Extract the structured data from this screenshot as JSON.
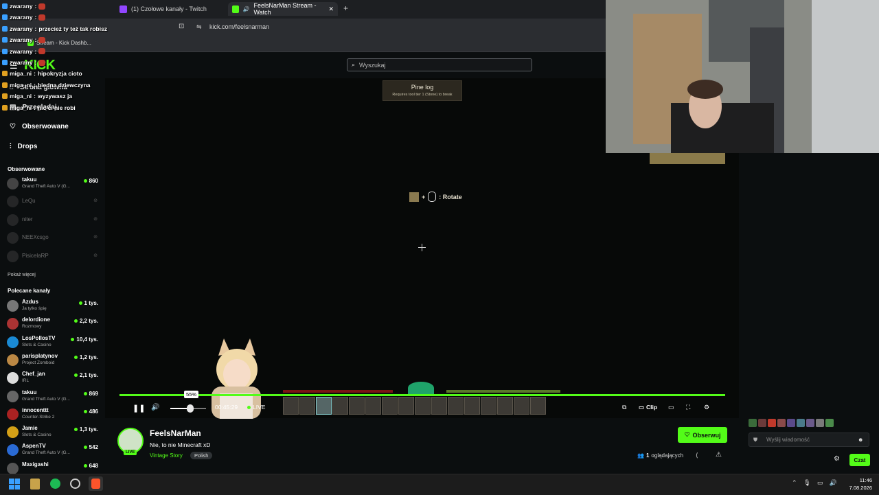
{
  "browser": {
    "tabs": [
      {
        "label": "(1) Czołowe kanały - Twitch",
        "active": false
      },
      {
        "label": "FeelsNarMan Stream - Watch",
        "active": true
      }
    ],
    "url": "kick.com/feelsnarman",
    "bookmark": "Stream - Kick Dashb..."
  },
  "kick": {
    "search_placeholder": "Wyszukaj",
    "nav": [
      "Strona główna",
      "Przeglądaj",
      "Obserwowane",
      "Drops"
    ],
    "followed_header": "Obserwowane",
    "followed": [
      {
        "name": "takuu",
        "category": "Grand Theft Auto V (G...",
        "viewers": "860",
        "live": true
      },
      {
        "name": "LeQu",
        "live": false
      },
      {
        "name": "niter",
        "live": false
      },
      {
        "name": "NEEXcsgo",
        "live": false
      },
      {
        "name": "PisicelaRP",
        "live": false
      }
    ],
    "show_more": "Pokaż więcej",
    "recommended_header": "Polecane kanały",
    "recommended": [
      {
        "name": "Azdus",
        "category": "Ja tylko śpię",
        "viewers": "1 tys."
      },
      {
        "name": "delordione",
        "category": "Rozmowy",
        "viewers": "2,2 tys."
      },
      {
        "name": "LosPollosTV",
        "category": "Slots & Casino",
        "viewers": "10,4 tys."
      },
      {
        "name": "parisplatynov",
        "category": "Project Zomboid",
        "viewers": "1,2 tys."
      },
      {
        "name": "Chef_jan",
        "category": "IRL",
        "viewers": "2,1 tys."
      },
      {
        "name": "takuu",
        "category": "Grand Theft Auto V (G...",
        "viewers": "869"
      },
      {
        "name": "innocenttt",
        "category": "Counter-Strike 2",
        "viewers": "486"
      },
      {
        "name": "Jamie",
        "category": "Slots & Casino",
        "viewers": "1,3 tys."
      },
      {
        "name": "AspenTV",
        "category": "Grand Theft Auto V (G...",
        "viewers": "542"
      },
      {
        "name": "Maxigashi",
        "category": "",
        "viewers": "648"
      }
    ]
  },
  "chat_overlay": [
    {
      "user": "zwarany",
      "text": ""
    },
    {
      "user": "zwarany",
      "text": ""
    },
    {
      "user": "zwarany",
      "text": "przecież ty też tak robisz"
    },
    {
      "user": "zwarany",
      "text": ""
    },
    {
      "user": "zwarany",
      "text": ""
    },
    {
      "user": "zwarany",
      "text": ""
    },
    {
      "user": "miga_ni",
      "text": "hipokryzja cioto"
    },
    {
      "user": "miga_ni",
      "text": "biedna dziewczyna"
    },
    {
      "user": "miga_ni",
      "text": "wyzywasz ja"
    },
    {
      "user": "miga_ni",
      "text": "nic ci nie robi"
    }
  ],
  "game": {
    "tooltip_title": "Pine log",
    "tooltip_sub": "Requires tool tier 1 (Stone) to break",
    "rotate_label": ": Rotate"
  },
  "player": {
    "volume_tooltip": "55%",
    "volume": 0.55,
    "time": "00:45:29",
    "live_label": "LIVE",
    "clip_label": "Clip"
  },
  "stream": {
    "streamer": "FeelsNarMan",
    "title": "Nie, to nie Minecraft xD",
    "game": "Vintage Story",
    "language": "Polish",
    "avatar_badge": "LIVE",
    "follow_label": "Obserwuj",
    "viewers_count": "1",
    "viewers_label": "oglądających"
  },
  "chat": {
    "placeholder": "Wyślij wiadomość",
    "send_label": "Czat"
  },
  "taskbar": {
    "time": "11:46",
    "date": "7.08.2026"
  },
  "colors": {
    "accent": "#53fc18",
    "bg": "#0b0e0f"
  }
}
